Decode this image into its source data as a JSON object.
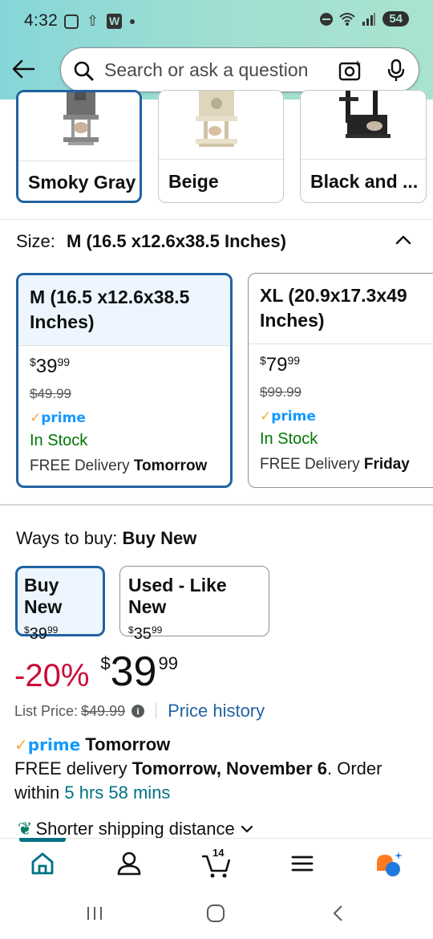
{
  "status_bar": {
    "time": "4:32",
    "battery": "54"
  },
  "search": {
    "placeholder": "Search or ask a question"
  },
  "colors": [
    {
      "label": "Smoky Gray",
      "selected": true
    },
    {
      "label": "Beige",
      "selected": false
    },
    {
      "label": "Black and ...",
      "selected": false
    }
  ],
  "size": {
    "label": "Size:",
    "value": "M (16.5 x12.6x38.5 Inches)",
    "options": [
      {
        "name": "M (16.5 x12.6x38.5 Inches)",
        "price_whole": "39",
        "price_fraction": "99",
        "list_price": "$49.99",
        "availability": "In Stock",
        "delivery_prefix": "FREE Delivery",
        "delivery_day": "Tomorrow",
        "selected": true
      },
      {
        "name": "XL (20.9x17.3x49 Inches)",
        "price_whole": "79",
        "price_fraction": "99",
        "list_price": "$99.99",
        "availability": "In Stock",
        "delivery_prefix": "FREE Delivery",
        "delivery_day": "Friday",
        "selected": false
      }
    ]
  },
  "ways_to_buy": {
    "label": "Ways to buy:",
    "value": "Buy New",
    "options": [
      {
        "title": "Buy New",
        "price_whole": "39",
        "price_fraction": "99",
        "selected": true
      },
      {
        "title": "Used - Like New",
        "price_whole": "35",
        "price_fraction": "99",
        "selected": false
      }
    ]
  },
  "price": {
    "discount": "-20%",
    "currency": "$",
    "whole": "39",
    "fraction": "99",
    "list_label": "List Price:",
    "list_value": "$49.99",
    "history_link": "Price history"
  },
  "delivery": {
    "prime_word": "prime",
    "headline": "Tomorrow",
    "text_prefix": "FREE delivery",
    "date": "Tomorrow, November 6",
    "order_within_prefix": ". Order within",
    "countdown": "5 hrs 58 mins"
  },
  "shipping": {
    "label": "Shorter shipping distance"
  },
  "nav": {
    "cart_count": "14"
  },
  "brand_colors": {
    "accent_blue": "#2162a1",
    "prime_blue": "#1399ff",
    "deal_red": "#cc0c39",
    "stock_green": "#007600",
    "teal": "#007185"
  },
  "prime_label": "prime",
  "currency_symbol": "$"
}
